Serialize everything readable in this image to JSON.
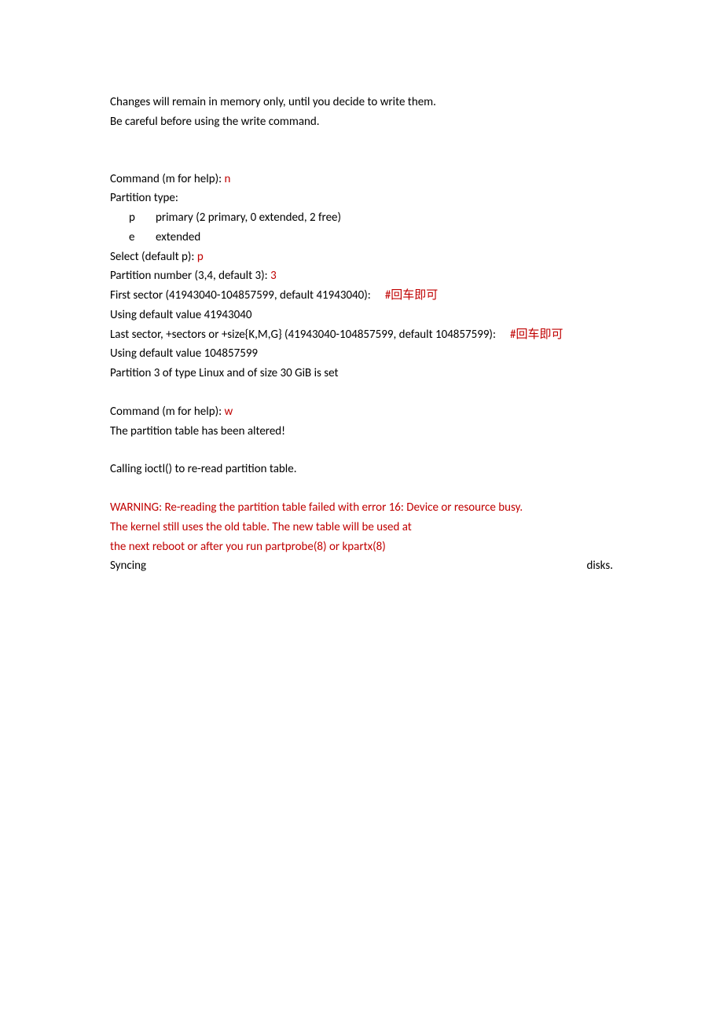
{
  "doc": {
    "intro_line1": "Changes will remain in memory only, until you decide to write them.",
    "intro_line2": "Be careful before using the write command.",
    "cmd1_prompt": "Command (m for help): ",
    "cmd1_input": "n",
    "ptype_header": "Partition type:",
    "ptype_p_letter": "p",
    "ptype_p_desc": "primary (2 primary, 0 extended, 2 free)",
    "ptype_e_letter": "e",
    "ptype_e_desc": "extended",
    "select_prompt": "Select (default p): ",
    "select_input": "p",
    "partnum_prompt": "Partition number (3,4, default 3): ",
    "partnum_input": "3",
    "first_sector_prompt": "First sector (41943040-104857599, default 41943040):",
    "first_sector_note": "#回车即可",
    "using_default1": "Using default value 41943040",
    "last_sector_prompt": "Last sector, +sectors or +size{K,M,G} (41943040-104857599, default 104857599):",
    "last_sector_note": "#回车即可",
    "using_default2": "Using default value 104857599",
    "part3_set": "Partition 3 of type Linux and of size 30 GiB is set",
    "cmd2_prompt": "Command (m for help): ",
    "cmd2_input": "w",
    "altered": "The partition table has been altered!",
    "ioctl": "Calling ioctl() to re-read partition table.",
    "warn1": "WARNING: Re-reading the partition table failed with error 16: Device or resource busy.",
    "warn2": "The kernel still uses the old table. The new table will be used at",
    "warn3": "the next reboot or after you run partprobe(8) or kpartx(8)",
    "sync_left": "Syncing",
    "sync_right": "disks."
  }
}
